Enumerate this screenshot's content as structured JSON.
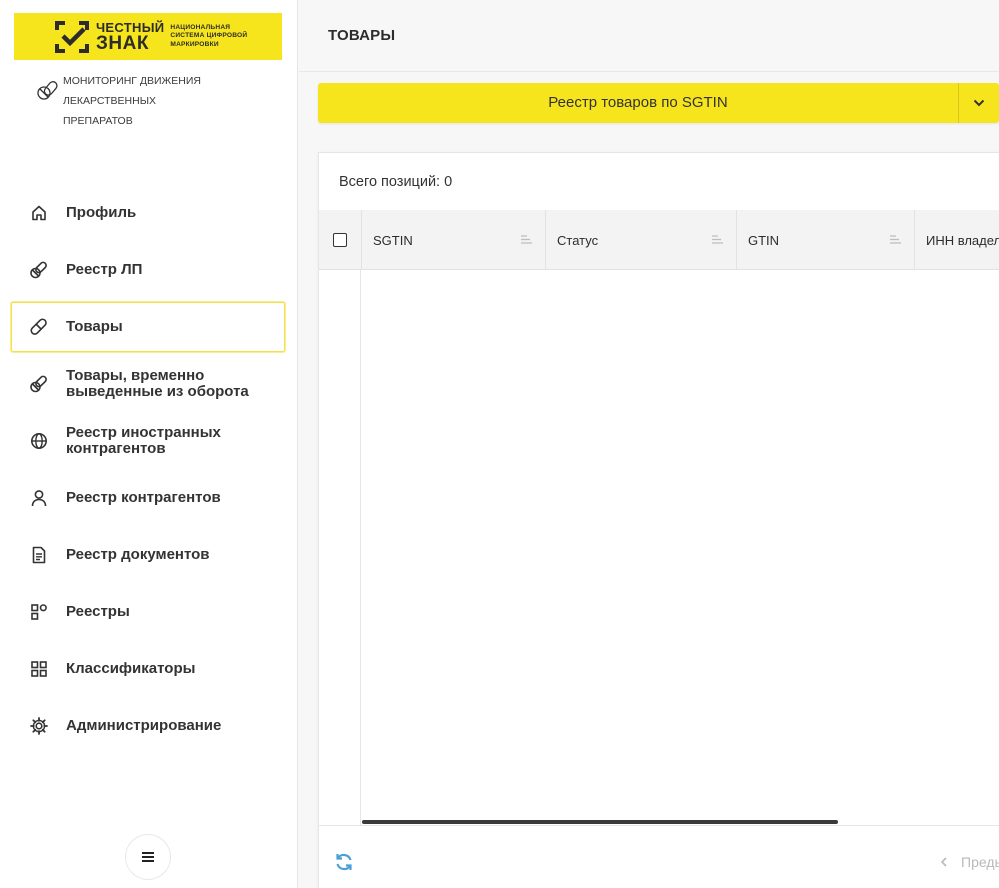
{
  "brand": {
    "line1": "ЧЕСТНЫЙ",
    "line2": "ЗНАК",
    "sub1": "НАЦИОНАЛЬНАЯ",
    "sub2": "СИСТЕМА ЦИФРОВОЙ",
    "sub3": "МАРКИРОВКИ",
    "product_line1": "МОНИТОРИНГ ДВИЖЕНИЯ ЛЕКАРСТВЕННЫХ",
    "product_line2": "ПРЕПАРАТОВ"
  },
  "nav": {
    "items": [
      {
        "label": "Профиль",
        "icon": "home-icon",
        "active": false
      },
      {
        "label": "Реестр ЛП",
        "icon": "pills-icon",
        "active": false
      },
      {
        "label": "Товары",
        "icon": "capsule-icon",
        "active": true
      },
      {
        "label": "Товары, временно выведенные из оборота",
        "icon": "pills-icon",
        "active": false
      },
      {
        "label": "Реестр иностранных контрагентов",
        "icon": "globe-icon",
        "active": false
      },
      {
        "label": "Реестр контрагентов",
        "icon": "user-icon",
        "active": false
      },
      {
        "label": "Реестр документов",
        "icon": "document-icon",
        "active": false
      },
      {
        "label": "Реестры",
        "icon": "registries-icon",
        "active": false
      },
      {
        "label": "Классификаторы",
        "icon": "grid-icon",
        "active": false
      },
      {
        "label": "Администрирование",
        "icon": "gear-icon",
        "active": false
      }
    ]
  },
  "header": {
    "title": "ТОВАРЫ"
  },
  "registry_select": {
    "selected": "Реестр товаров по SGTIN"
  },
  "table": {
    "total_label": "Всего позиций: 0",
    "columns": [
      "SGTIN",
      "Статус",
      "GTIN",
      "ИНН владел"
    ],
    "rows": []
  },
  "pager": {
    "prev_label": "Преды"
  },
  "colors": {
    "accent": "#f6e51c",
    "active_border": "#f1e14a",
    "refresh": "#4a9fd8"
  }
}
